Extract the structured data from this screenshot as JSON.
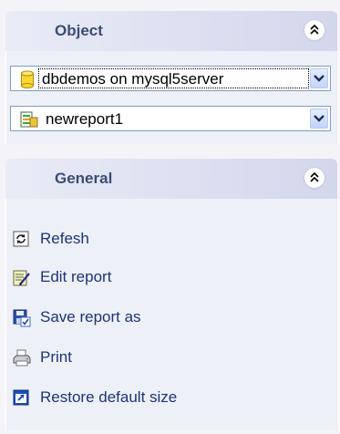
{
  "object_section": {
    "title": "Object",
    "database_combo": {
      "value": "dbdemos on mysql5server"
    },
    "report_combo": {
      "value": "newreport1"
    }
  },
  "general_section": {
    "title": "General",
    "actions": [
      {
        "label": "Refesh",
        "icon": "refresh-icon"
      },
      {
        "label": "Edit report",
        "icon": "edit-report-icon"
      },
      {
        "label": "Save report as",
        "icon": "save-icon"
      },
      {
        "label": "Print",
        "icon": "printer-icon"
      },
      {
        "label": "Restore default size",
        "icon": "restore-window-icon"
      }
    ]
  },
  "colors": {
    "header_gradient_start": "#e9ebf6",
    "header_gradient_end": "#d3d7ec",
    "header_text": "#3c4d73",
    "link_text": "#1d3475",
    "pane_background": "#eef0f8"
  }
}
